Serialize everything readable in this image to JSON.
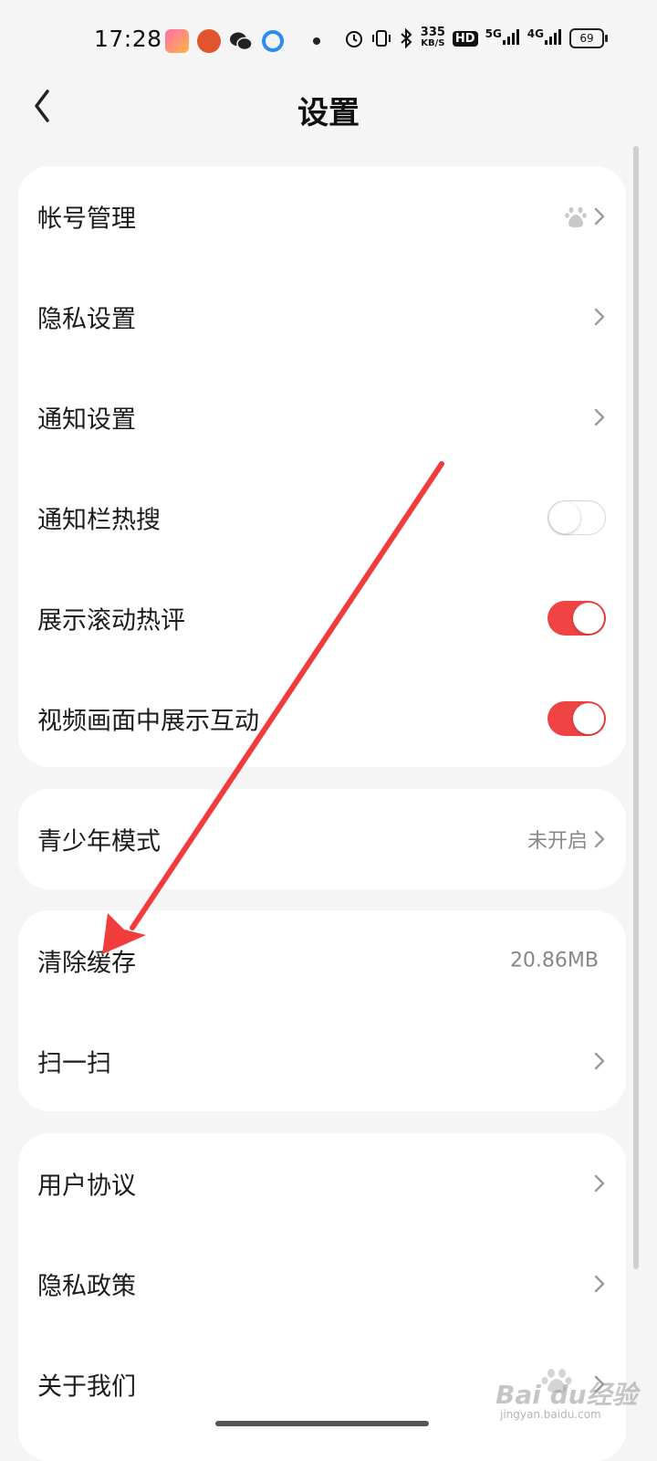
{
  "status_bar": {
    "time": "17:28",
    "net_speed_value": "335",
    "net_speed_unit": "KB/S",
    "hd_badge": "HD",
    "signal1": "5G",
    "signal2": "4G",
    "battery": "69"
  },
  "header": {
    "title": "设置"
  },
  "card1": {
    "items": [
      {
        "label": "帐号管理"
      },
      {
        "label": "隐私设置"
      },
      {
        "label": "通知设置"
      },
      {
        "label": "通知栏热搜",
        "toggle": "off"
      },
      {
        "label": "展示滚动热评",
        "toggle": "on"
      },
      {
        "label": "视频画面中展示互动",
        "toggle": "on"
      }
    ]
  },
  "card2": {
    "items": [
      {
        "label": "青少年模式",
        "value": "未开启"
      }
    ]
  },
  "card3": {
    "items": [
      {
        "label": "清除缓存",
        "value": "20.86MB"
      },
      {
        "label": "扫一扫"
      }
    ]
  },
  "card4": {
    "items": [
      {
        "label": "用户协议"
      },
      {
        "label": "隐私政策"
      },
      {
        "label": "关于我们"
      }
    ]
  },
  "watermark": {
    "text": "Bai du经验",
    "sub": "jingyan.baidu.com"
  },
  "colors": {
    "accent": "#f04343",
    "background": "#f5f5f5",
    "card": "#ffffff"
  }
}
